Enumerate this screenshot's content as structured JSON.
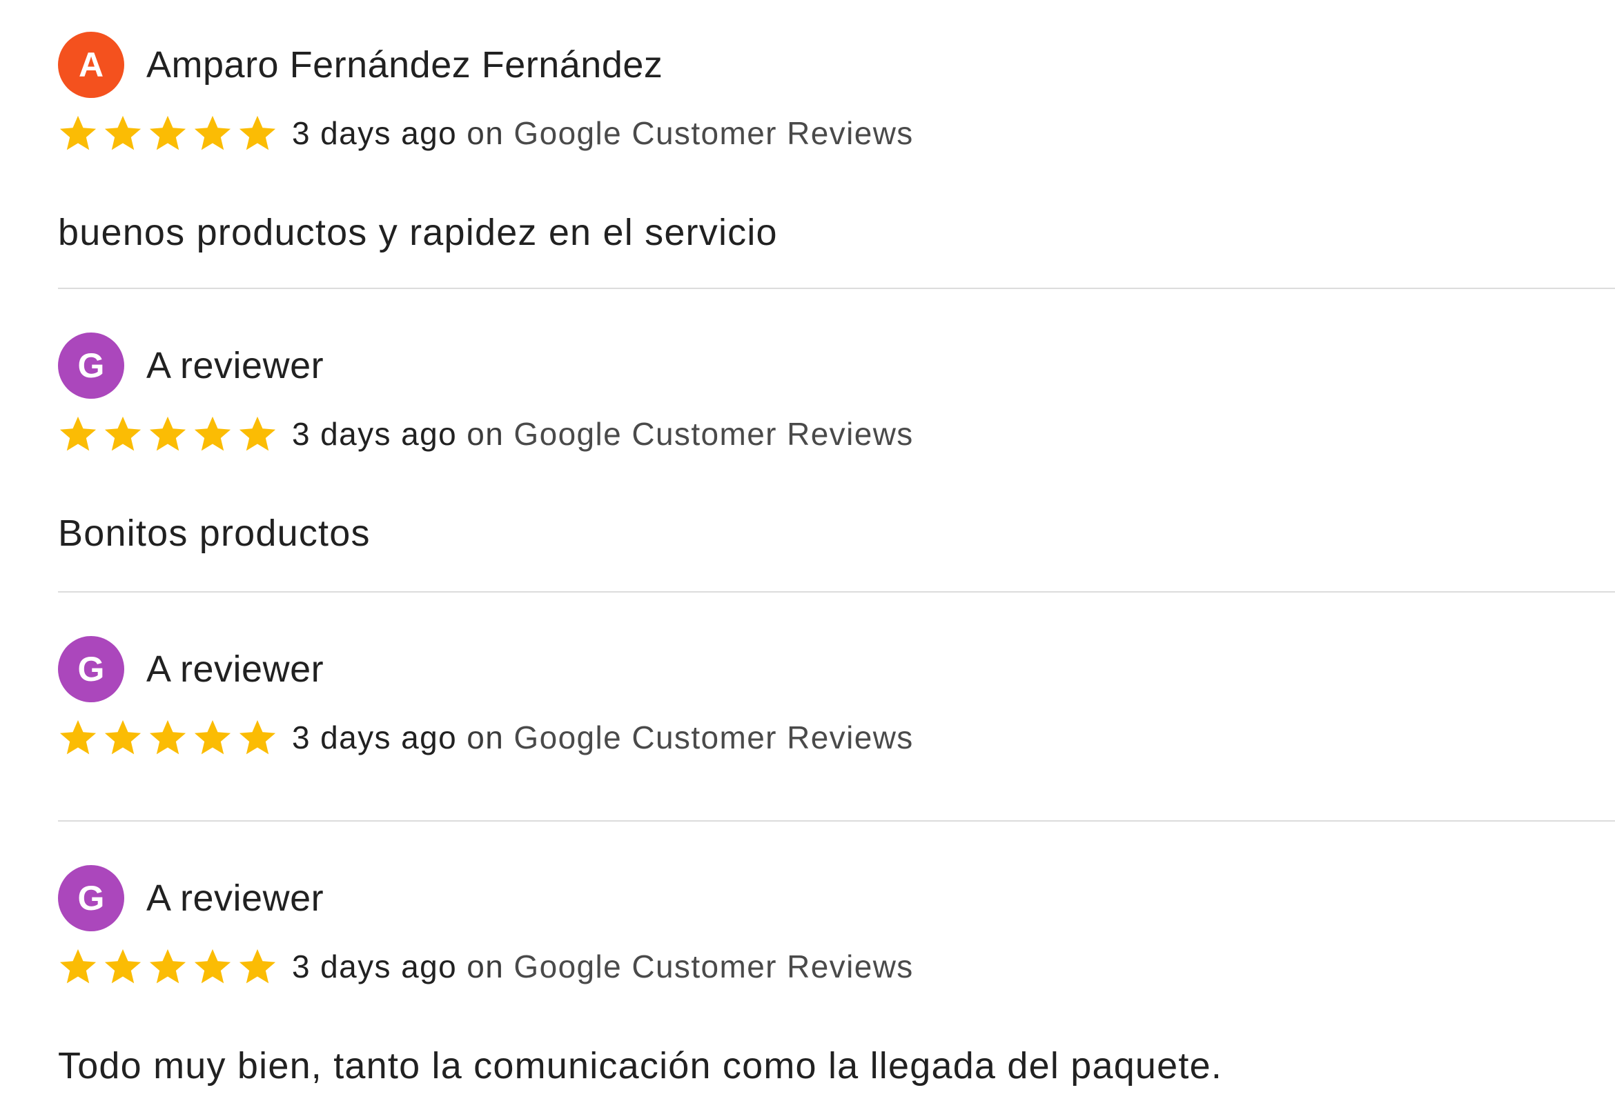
{
  "colors": {
    "star": "#FBBC04",
    "avatar_a": "#F4511E",
    "avatar_g": "#AB47BC",
    "divider": "#DCDCDC"
  },
  "reviews": [
    {
      "avatar_letter": "A",
      "avatar_color": "#F4511E",
      "name": "Amparo Fernández Fernández",
      "rating": 5,
      "time": "3 days ago",
      "source_prefix": "on",
      "source": "Google Customer Reviews",
      "text": "buenos productos y rapidez en el servicio"
    },
    {
      "avatar_letter": "G",
      "avatar_color": "#AB47BC",
      "name": "A reviewer",
      "rating": 5,
      "time": "3 days ago",
      "source_prefix": "on",
      "source": "Google Customer Reviews",
      "text": "Bonitos productos"
    },
    {
      "avatar_letter": "G",
      "avatar_color": "#AB47BC",
      "name": "A reviewer",
      "rating": 5,
      "time": "3 days ago",
      "source_prefix": "on",
      "source": "Google Customer Reviews",
      "text": ""
    },
    {
      "avatar_letter": "G",
      "avatar_color": "#AB47BC",
      "name": "A reviewer",
      "rating": 5,
      "time": "3 days ago",
      "source_prefix": "on",
      "source": "Google Customer Reviews",
      "text": "Todo muy bien, tanto la comunicación como la llegada del paquete."
    }
  ]
}
